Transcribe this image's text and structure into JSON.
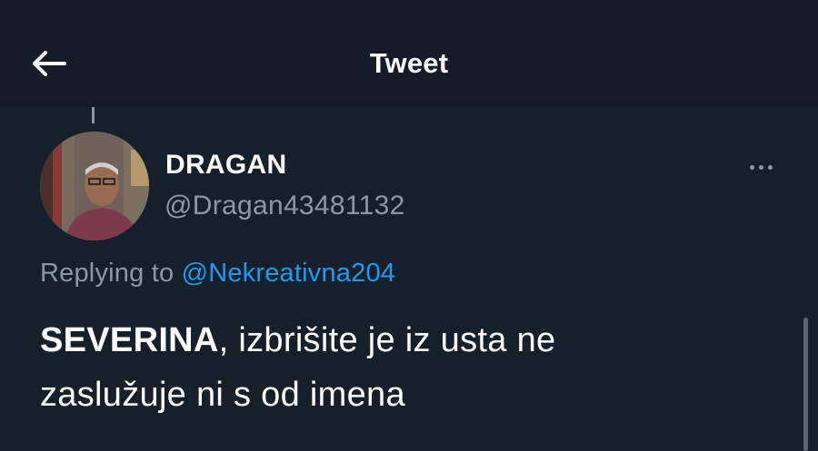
{
  "header": {
    "title": "Tweet",
    "back_icon": "arrow-left-icon"
  },
  "tweet": {
    "author": {
      "display_name": "DRAGAN",
      "handle": "@Dragan43481132",
      "avatar": "profile-photo"
    },
    "replying_to": {
      "prefix": "Replying to",
      "mention": "@Nekreativna204"
    },
    "text": {
      "bold_lead": "SEVERINA",
      "line1_rest": ", izbrišite je iz usta ne",
      "line2": "zaslužuje ni s od imena"
    },
    "more_icon": "more-horizontal-icon"
  },
  "colors": {
    "background": "#15202b",
    "text_primary": "#ffffff",
    "text_secondary": "#8b98a5",
    "link": "#1d9bf0"
  }
}
